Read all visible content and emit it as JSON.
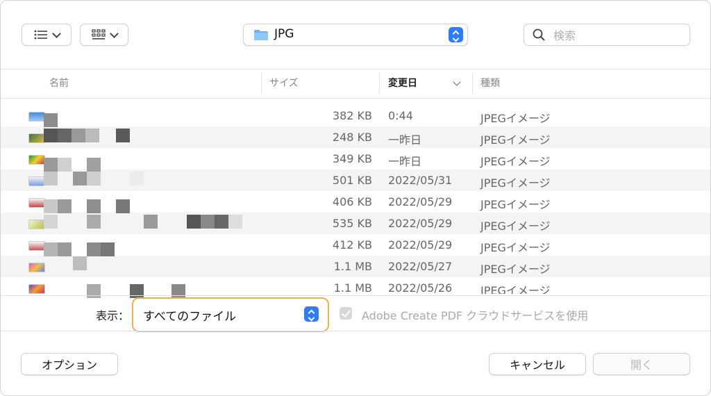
{
  "toolbar": {
    "path_label": "JPG",
    "search_placeholder": "検索"
  },
  "columns": {
    "name": "名前",
    "size": "サイズ",
    "date": "変更日",
    "kind": "種類"
  },
  "files": [
    {
      "size": "382 KB",
      "date": "0:44",
      "kind": "JPEGイメージ"
    },
    {
      "size": "248 KB",
      "date": "一昨日",
      "kind": "JPEGイメージ"
    },
    {
      "size": "349 KB",
      "date": "一昨日",
      "kind": "JPEGイメージ"
    },
    {
      "size": "501 KB",
      "date": "2022/05/31",
      "kind": "JPEGイメージ"
    },
    {
      "size": "406 KB",
      "date": "2022/05/29",
      "kind": "JPEGイメージ"
    },
    {
      "size": "535 KB",
      "date": "2022/05/29",
      "kind": "JPEGイメージ"
    },
    {
      "size": "412 KB",
      "date": "2022/05/29",
      "kind": "JPEGイメージ"
    },
    {
      "size": "1.1 MB",
      "date": "2022/05/27",
      "kind": "JPEGイメージ"
    },
    {
      "size": "1.1 MB",
      "date": "2022/05/26",
      "kind": "JPEGイメージ"
    }
  ],
  "filter": {
    "label": "表示：",
    "value": "すべてのファイル",
    "highlight_color": "#e8b44d"
  },
  "checkbox": {
    "label": "Adobe Create PDF クラウドサービスを使用",
    "checked": true
  },
  "buttons": {
    "options": "オプション",
    "cancel": "キャンセル",
    "open": "開く"
  }
}
